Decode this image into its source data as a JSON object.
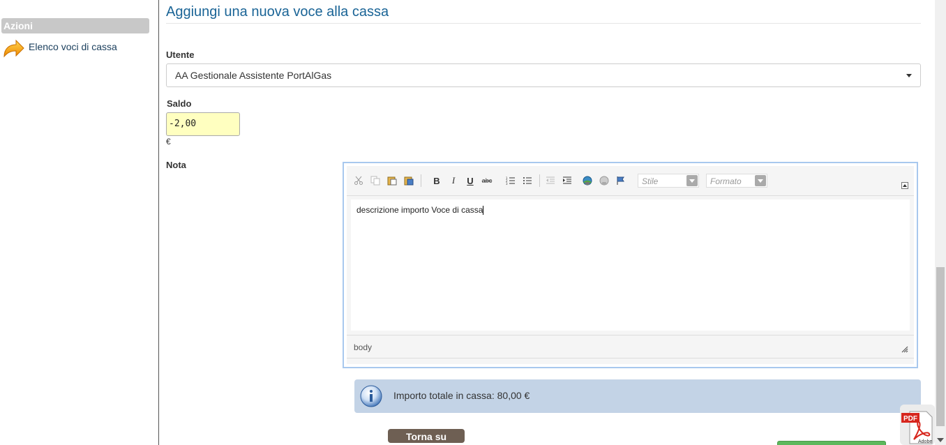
{
  "sidebar": {
    "section_title": "Azioni",
    "link_label": "Elenco voci di cassa",
    "link_icon": "orange-arrow-icon"
  },
  "form": {
    "title": "Aggiungi una nuova voce alla cassa",
    "utente": {
      "label": "Utente",
      "value": "AA Gestionale Assistente PortAlGas"
    },
    "saldo": {
      "label": "Saldo",
      "value": "-2,00",
      "unit": "€"
    },
    "nota": {
      "label": "Nota",
      "toolbar": {
        "bold": "B",
        "italic": "I",
        "underline": "U",
        "strike": "abc",
        "style_placeholder": "Stile",
        "format_placeholder": "Formato"
      },
      "content": "descrizione importo Voce di cassa",
      "status_path": "body"
    }
  },
  "info": {
    "text": "Importo totale in cassa: 80,00 €",
    "icon": "info-icon"
  },
  "buttons": {
    "back_to_top": "Torna su"
  },
  "colors": {
    "title": "#1a6496",
    "saldo_bg": "#ffffc0",
    "info_bg": "#c3d3e6",
    "back_button": "#6e5f53"
  }
}
